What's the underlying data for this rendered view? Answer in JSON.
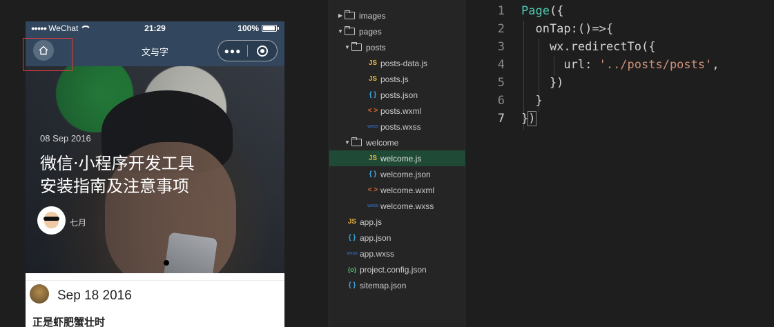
{
  "simulator": {
    "status_bar": {
      "carrier": "WeChat",
      "time": "21:29",
      "battery": "100%"
    },
    "nav": {
      "title": "文与字"
    },
    "banner": {
      "date": "08 Sep 2016",
      "title_line1": "微信·小程序开发工具",
      "title_line2": "安装指南及注意事项",
      "author": "七月"
    },
    "post": {
      "date": "Sep 18 2016",
      "title": "正是虾肥蟹壮时"
    }
  },
  "file_tree": {
    "items": [
      {
        "name": "images",
        "type": "folder",
        "expanded": false,
        "depth": 0
      },
      {
        "name": "pages",
        "type": "folder",
        "expanded": true,
        "depth": 0
      },
      {
        "name": "posts",
        "type": "folder",
        "expanded": true,
        "depth": 1
      },
      {
        "name": "posts-data.js",
        "type": "js",
        "depth": 2
      },
      {
        "name": "posts.js",
        "type": "js",
        "depth": 2
      },
      {
        "name": "posts.json",
        "type": "json",
        "depth": 2
      },
      {
        "name": "posts.wxml",
        "type": "wxml",
        "depth": 2
      },
      {
        "name": "posts.wxss",
        "type": "wxss",
        "depth": 2
      },
      {
        "name": "welcome",
        "type": "folder",
        "expanded": true,
        "depth": 1
      },
      {
        "name": "welcome.js",
        "type": "js",
        "depth": 2,
        "selected": true
      },
      {
        "name": "welcome.json",
        "type": "json",
        "depth": 2
      },
      {
        "name": "welcome.wxml",
        "type": "wxml",
        "depth": 2
      },
      {
        "name": "welcome.wxss",
        "type": "wxss",
        "depth": 2
      },
      {
        "name": "app.js",
        "type": "js",
        "depth": 0
      },
      {
        "name": "app.json",
        "type": "json",
        "depth": 0
      },
      {
        "name": "app.wxss",
        "type": "wxss",
        "depth": 0
      },
      {
        "name": "project.config.json",
        "type": "config",
        "depth": 0
      },
      {
        "name": "sitemap.json",
        "type": "json",
        "depth": 0
      }
    ],
    "icon_glyphs": {
      "js": "JS",
      "json": "{ }",
      "wxml": "< >",
      "wxss": "wxss",
      "config": "{o}"
    }
  },
  "editor": {
    "line_numbers": [
      "1",
      "2",
      "3",
      "4",
      "5",
      "6",
      "7"
    ],
    "current_line": "7",
    "lines": {
      "l1_kw": "Page",
      "l1_rest": "({",
      "l2": "  onTap:()=>{",
      "l3": "    wx.redirectTo({",
      "l4_key": "      url: ",
      "l4_str": "'../posts/posts'",
      "l4_tail": ",",
      "l5": "    })",
      "l6": "  }",
      "l7_a": "}",
      "l7_b": ")"
    }
  },
  "colors": {
    "nav_bg": "#32475d",
    "selected_row": "#1f4a36",
    "keyword": "#4ec9b0",
    "string": "#ce9178",
    "highlight_box": "#e23b3b"
  }
}
